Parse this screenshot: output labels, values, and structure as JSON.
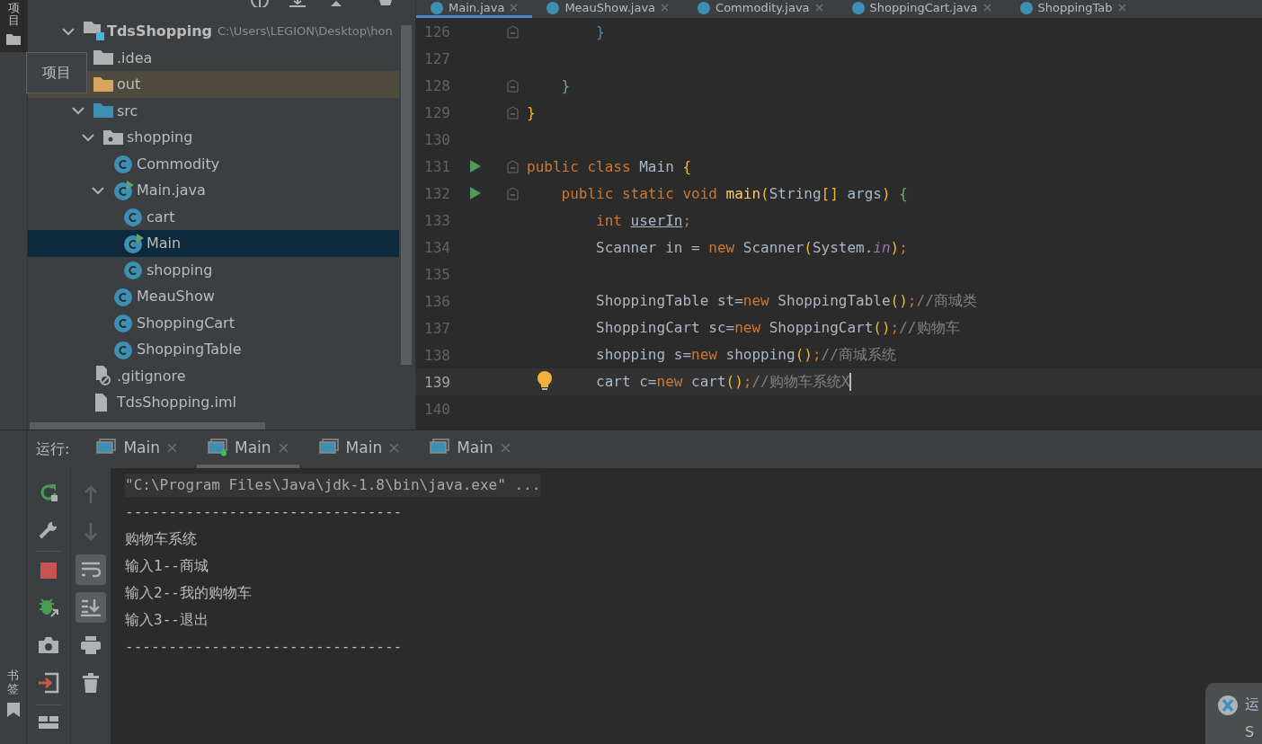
{
  "left_strip": {
    "top_label": "项目",
    "bottom_label": "书签"
  },
  "tooltip": {
    "text": "项目"
  },
  "project_tree": {
    "name": "TdsShopping",
    "path": "C:\\Users\\LEGION\\Desktop\\hon",
    "kind": "module",
    "expanded": true,
    "selected": false,
    "children": [
      {
        "name": ".idea",
        "kind": "folder",
        "expanded": false,
        "selected": false
      },
      {
        "name": "out",
        "kind": "excluded",
        "expanded": false,
        "selected": false
      },
      {
        "name": "src",
        "kind": "source",
        "expanded": true,
        "selected": false,
        "children": [
          {
            "name": "shopping",
            "kind": "package",
            "expanded": true,
            "selected": false,
            "children": [
              {
                "name": "Commodity",
                "kind": "class",
                "selected": false,
                "runnable": false
              },
              {
                "name": "Main.java",
                "kind": "class",
                "expanded": true,
                "selected": false,
                "runnable": true,
                "children": [
                  {
                    "name": "cart",
                    "kind": "class",
                    "selected": false,
                    "runnable": false
                  },
                  {
                    "name": "Main",
                    "kind": "class",
                    "selected": true,
                    "runnable": true
                  },
                  {
                    "name": "shopping",
                    "kind": "class",
                    "selected": false,
                    "runnable": false
                  }
                ]
              },
              {
                "name": "MeauShow",
                "kind": "class",
                "selected": false,
                "runnable": false
              },
              {
                "name": "ShoppingCart",
                "kind": "class",
                "selected": false,
                "runnable": false
              },
              {
                "name": "ShoppingTable",
                "kind": "class",
                "selected": false,
                "runnable": false
              }
            ]
          }
        ]
      },
      {
        "name": ".gitignore",
        "kind": "ignore",
        "selected": false
      },
      {
        "name": "TdsShopping.iml",
        "kind": "file",
        "selected": false
      }
    ]
  },
  "editor_tabs": [
    {
      "label": "Main.java",
      "selected": true
    },
    {
      "label": "MeauShow.java",
      "selected": false
    },
    {
      "label": "Commodity.java",
      "selected": false
    },
    {
      "label": "ShoppingCart.java",
      "selected": false
    },
    {
      "label": "ShoppingTab",
      "selected": false
    }
  ],
  "code_lines": [
    {
      "number": "126",
      "run": false,
      "fold": true,
      "current": false,
      "bulb": false,
      "kind": "nested2",
      "tokens": [
        {
          "text": "}",
          "kind": "brace_blue"
        }
      ]
    },
    {
      "number": "127",
      "run": false,
      "fold": false,
      "current": false,
      "bulb": false
    },
    {
      "number": "128",
      "run": false,
      "fold": true,
      "current": false,
      "bulb": false,
      "kind": "nested1",
      "tokens": [
        {
          "text": "}",
          "kind": "brace_green"
        }
      ]
    },
    {
      "number": "129",
      "run": false,
      "fold": true,
      "current": false,
      "bulb": false,
      "kind": "top",
      "tokens": [
        {
          "text": "}",
          "kind": "brace_yellow"
        }
      ]
    },
    {
      "number": "130",
      "run": false,
      "fold": false,
      "current": false,
      "bulb": false
    },
    {
      "number": "131",
      "run": true,
      "fold": true,
      "current": false,
      "bulb": false,
      "kind": "top",
      "tokens": [
        {
          "text": "public class",
          "kind": "keyword"
        },
        {
          "text": " Main ",
          "kind": "plain"
        },
        {
          "text": "{",
          "kind": "brace_yellow"
        }
      ]
    },
    {
      "number": "132",
      "run": true,
      "fold": true,
      "current": false,
      "bulb": false,
      "kind": "nested1",
      "tokens": [
        {
          "text": "public static void ",
          "kind": "keyword"
        },
        {
          "text": "main",
          "kind": "method"
        },
        {
          "text": "(",
          "kind": "brace_yellow"
        },
        {
          "text": "String",
          "kind": "plain"
        },
        {
          "text": "[]",
          "kind": "brace_yellow"
        },
        {
          "text": " args",
          "kind": "plain"
        },
        {
          "text": ")",
          "kind": "brace_yellow"
        },
        {
          "text": " {",
          "kind": "brace_green"
        }
      ]
    },
    {
      "number": "133",
      "run": false,
      "fold": false,
      "current": false,
      "bulb": false,
      "kind": "nested2",
      "tokens": [
        {
          "text": "int ",
          "kind": "keyword"
        },
        {
          "text": "userIn",
          "kind": "underlined"
        },
        {
          "text": ";",
          "kind": "keyword"
        }
      ]
    },
    {
      "number": "134",
      "run": false,
      "fold": false,
      "current": false,
      "bulb": false,
      "kind": "nested2",
      "tokens": [
        {
          "text": "Scanner in = ",
          "kind": "plain"
        },
        {
          "text": "new",
          "kind": "keyword"
        },
        {
          "text": " Scanner",
          "kind": "plain"
        },
        {
          "text": "(",
          "kind": "brace_yellow"
        },
        {
          "text": "System.",
          "kind": "plain"
        },
        {
          "text": "in",
          "kind": "field"
        },
        {
          "text": ")",
          "kind": "brace_yellow"
        },
        {
          "text": ";",
          "kind": "keyword"
        }
      ]
    },
    {
      "number": "135",
      "run": false,
      "fold": false,
      "current": false,
      "bulb": false
    },
    {
      "number": "136",
      "run": false,
      "fold": false,
      "current": false,
      "bulb": false,
      "kind": "nested2",
      "tokens": [
        {
          "text": "ShoppingTable st=",
          "kind": "plain"
        },
        {
          "text": "new",
          "kind": "keyword"
        },
        {
          "text": " ShoppingTable",
          "kind": "plain"
        },
        {
          "text": "()",
          "kind": "brace_yellow"
        },
        {
          "text": ";",
          "kind": "keyword"
        },
        {
          "text": "//商城类",
          "kind": "comment"
        }
      ]
    },
    {
      "number": "137",
      "run": false,
      "fold": false,
      "current": false,
      "bulb": false,
      "kind": "nested2",
      "tokens": [
        {
          "text": "ShoppingCart sc=",
          "kind": "plain"
        },
        {
          "text": "new",
          "kind": "keyword"
        },
        {
          "text": " ShoppingCart",
          "kind": "plain"
        },
        {
          "text": "()",
          "kind": "brace_yellow"
        },
        {
          "text": ";",
          "kind": "keyword"
        },
        {
          "text": "//购物车",
          "kind": "comment"
        }
      ]
    },
    {
      "number": "138",
      "run": false,
      "fold": false,
      "current": false,
      "bulb": false,
      "kind": "nested2",
      "tokens": [
        {
          "text": "shopping s=",
          "kind": "plain"
        },
        {
          "text": "new",
          "kind": "keyword"
        },
        {
          "text": " shopping",
          "kind": "plain"
        },
        {
          "text": "()",
          "kind": "brace_yellow"
        },
        {
          "text": ";",
          "kind": "keyword"
        },
        {
          "text": "//商城系统",
          "kind": "comment"
        }
      ]
    },
    {
      "number": "139",
      "run": false,
      "fold": false,
      "current": true,
      "bulb": true,
      "kind": "nested2",
      "tokens": [
        {
          "text": "cart c=",
          "kind": "plain"
        },
        {
          "text": "new",
          "kind": "keyword"
        },
        {
          "text": " cart",
          "kind": "plain"
        },
        {
          "text": "()",
          "kind": "brace_yellow"
        },
        {
          "text": ";",
          "kind": "keyword"
        },
        {
          "text": "//购物车系统X",
          "kind": "comment"
        }
      ]
    },
    {
      "number": "140",
      "run": false,
      "fold": false,
      "current": false,
      "bulb": false
    }
  ],
  "run_panel": {
    "label": "运行:",
    "tabs": [
      {
        "label": "Main",
        "selected": false
      },
      {
        "label": "Main",
        "selected": true
      },
      {
        "label": "Main",
        "selected": false
      },
      {
        "label": "Main",
        "selected": false
      }
    ],
    "actions": [
      {
        "kind": "rerun"
      },
      {
        "kind": "wrench"
      },
      {
        "kind": "divider"
      },
      {
        "kind": "stop"
      },
      {
        "kind": "debug"
      },
      {
        "kind": "camera"
      },
      {
        "kind": "exit"
      },
      {
        "kind": "divider"
      },
      {
        "kind": "layout"
      }
    ],
    "console_tools": [
      {
        "kind": "up",
        "on": false
      },
      {
        "kind": "down",
        "on": false
      },
      {
        "kind": "wrap",
        "on": true
      },
      {
        "kind": "scroll_end",
        "on": true
      },
      {
        "kind": "print",
        "on": false
      },
      {
        "kind": "trash",
        "on": false
      }
    ],
    "console_lines": [
      {
        "text": "\"C:\\Program Files\\Java\\jdk-1.8\\bin\\java.exe\" ...",
        "kind": "command"
      },
      {
        "text": "--------------------------------",
        "kind": "output"
      },
      {
        "text": "购物车系统",
        "kind": "output"
      },
      {
        "text": "输入1--商城",
        "kind": "output"
      },
      {
        "text": "输入2--我的购物车",
        "kind": "output"
      },
      {
        "text": "输入3--退出",
        "kind": "output"
      },
      {
        "text": "--------------------------------",
        "kind": "output"
      }
    ]
  },
  "notification": {
    "title": "运",
    "body": "S"
  }
}
